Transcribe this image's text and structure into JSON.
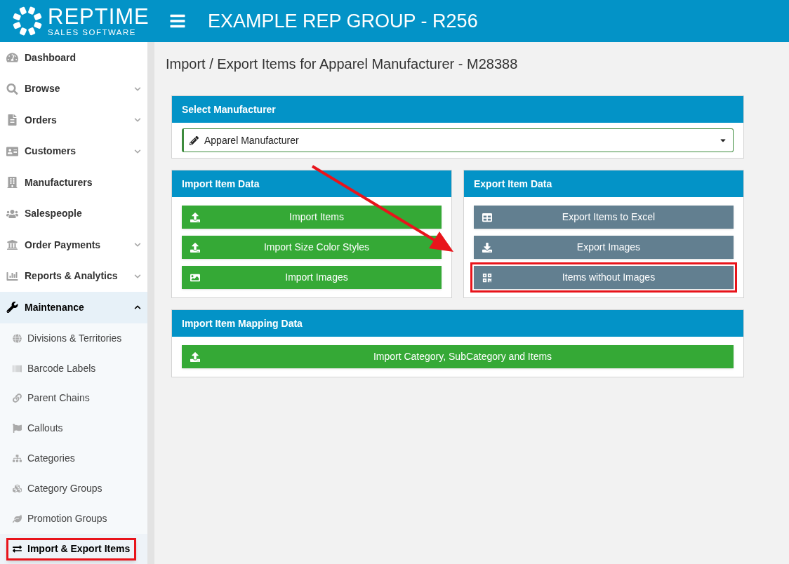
{
  "header": {
    "logo_title": "REPTIME",
    "logo_subtitle": "SALES SOFTWARE",
    "title": "EXAMPLE REP GROUP - R256"
  },
  "sidebar": {
    "items": [
      {
        "label": "Dashboard",
        "expandable": false,
        "expanded": false
      },
      {
        "label": "Browse",
        "expandable": true,
        "expanded": false
      },
      {
        "label": "Orders",
        "expandable": true,
        "expanded": false
      },
      {
        "label": "Customers",
        "expandable": true,
        "expanded": false
      },
      {
        "label": "Manufacturers",
        "expandable": false,
        "expanded": false
      },
      {
        "label": "Salespeople",
        "expandable": false,
        "expanded": false
      },
      {
        "label": "Order Payments",
        "expandable": true,
        "expanded": false
      },
      {
        "label": "Reports & Analytics",
        "expandable": true,
        "expanded": false
      },
      {
        "label": "Maintenance",
        "expandable": true,
        "expanded": true,
        "children": [
          {
            "label": "Divisions & Territories",
            "selected": false,
            "highlighted": false
          },
          {
            "label": "Barcode Labels",
            "selected": false,
            "highlighted": false
          },
          {
            "label": "Parent Chains",
            "selected": false,
            "highlighted": false
          },
          {
            "label": "Callouts",
            "selected": false,
            "highlighted": false
          },
          {
            "label": "Categories",
            "selected": false,
            "highlighted": false
          },
          {
            "label": "Category Groups",
            "selected": false,
            "highlighted": false
          },
          {
            "label": "Promotion Groups",
            "selected": false,
            "highlighted": false
          },
          {
            "label": "Import & Export Items",
            "selected": true,
            "highlighted": true
          }
        ]
      }
    ]
  },
  "page_title": "Import / Export Items for Apparel Manufacturer - M28388",
  "manufacturer_panel": {
    "title": "Select Manufacturer",
    "value": "Apparel Manufacturer"
  },
  "panels": [
    {
      "title": "Import Item Data",
      "buttons": [
        {
          "label": "Import Items",
          "kind": "import",
          "highlighted": false
        },
        {
          "label": "Import Size Color Styles",
          "kind": "import",
          "highlighted": false
        },
        {
          "label": "Import Images",
          "kind": "import",
          "highlighted": false
        }
      ]
    },
    {
      "title": "Export Item Data",
      "buttons": [
        {
          "label": "Export Items to Excel",
          "kind": "export",
          "highlighted": false
        },
        {
          "label": "Export Images",
          "kind": "export",
          "highlighted": false
        },
        {
          "label": "Items without Images",
          "kind": "export",
          "highlighted": true
        }
      ]
    }
  ],
  "mapping_panel": {
    "title": "Import Item Mapping Data",
    "buttons": [
      {
        "label": "Import Category, SubCategory and Items",
        "kind": "import",
        "highlighted": false
      }
    ]
  }
}
